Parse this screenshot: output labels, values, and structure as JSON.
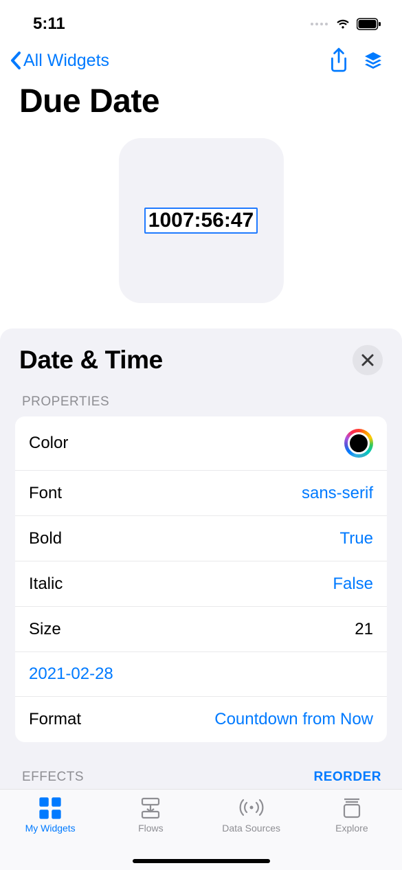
{
  "status": {
    "time": "5:11"
  },
  "nav": {
    "back_label": "All Widgets"
  },
  "page": {
    "title": "Due Date"
  },
  "preview": {
    "countdown": "1007:56:47"
  },
  "sheet": {
    "title": "Date & Time",
    "sections": {
      "properties": {
        "label": "PROPERTIES",
        "rows": {
          "color": {
            "label": "Color",
            "value_hex": "#000000"
          },
          "font": {
            "label": "Font",
            "value": "sans-serif"
          },
          "bold": {
            "label": "Bold",
            "value": "True"
          },
          "italic": {
            "label": "Italic",
            "value": "False"
          },
          "size": {
            "label": "Size",
            "value": "21"
          },
          "date": {
            "value": "2021-02-28"
          },
          "format": {
            "label": "Format",
            "value": "Countdown from Now"
          }
        }
      },
      "effects": {
        "label": "EFFECTS",
        "reorder": "REORDER"
      }
    }
  },
  "tabs": {
    "my_widgets": "My Widgets",
    "flows": "Flows",
    "data_sources": "Data Sources",
    "explore": "Explore"
  }
}
